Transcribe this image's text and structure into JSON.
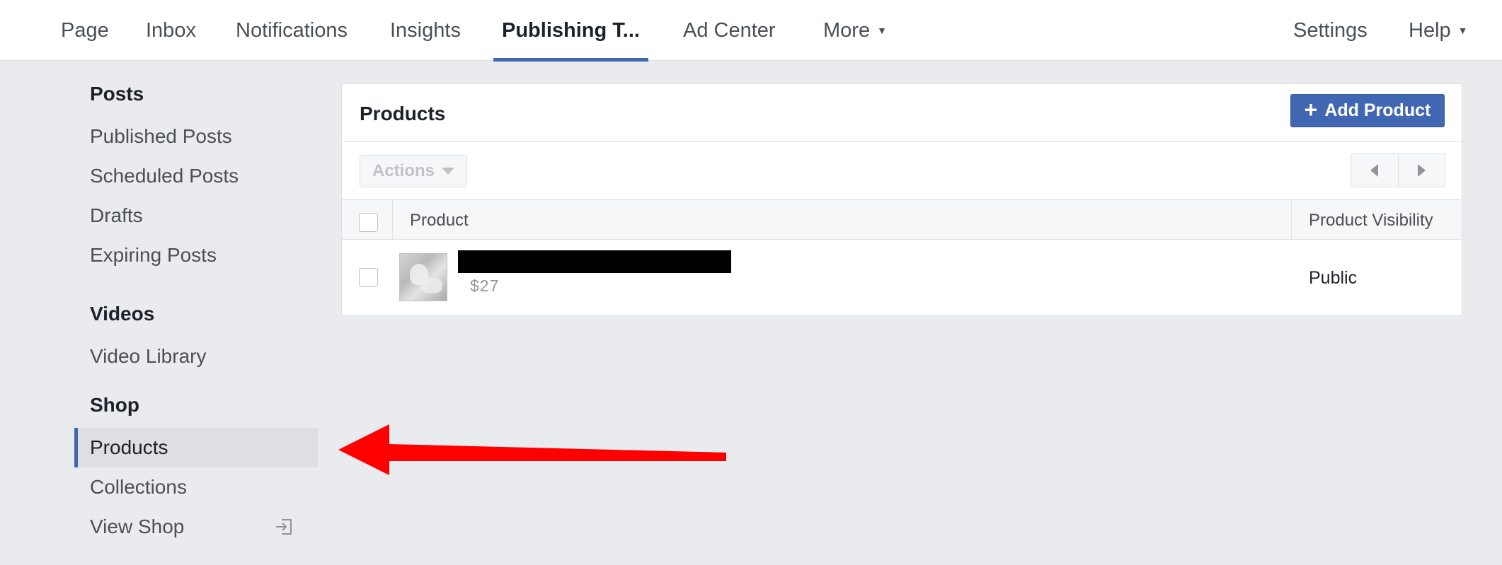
{
  "nav": {
    "items": [
      {
        "label": "Page"
      },
      {
        "label": "Inbox"
      },
      {
        "label": "Notifications"
      },
      {
        "label": "Insights"
      },
      {
        "label": "Publishing T..."
      },
      {
        "label": "Ad Center"
      },
      {
        "label": "More"
      }
    ],
    "right": [
      {
        "label": "Settings"
      },
      {
        "label": "Help"
      }
    ],
    "active_index": 4
  },
  "sidebar": {
    "posts": {
      "heading": "Posts",
      "items": [
        {
          "label": "Published Posts"
        },
        {
          "label": "Scheduled Posts"
        },
        {
          "label": "Drafts"
        },
        {
          "label": "Expiring Posts"
        }
      ]
    },
    "videos": {
      "heading": "Videos",
      "items": [
        {
          "label": "Video Library"
        }
      ]
    },
    "shop": {
      "heading": "Shop",
      "items": [
        {
          "label": "Products",
          "selected": true
        },
        {
          "label": "Collections"
        },
        {
          "label": "View Shop"
        }
      ]
    }
  },
  "products_panel": {
    "title": "Products",
    "add_button": "Add Product",
    "actions_label": "Actions",
    "columns": {
      "product": "Product",
      "visibility": "Product Visibility"
    },
    "rows": [
      {
        "price": "$27",
        "visibility": "Public",
        "name_redacted": true
      }
    ]
  },
  "colors": {
    "accent": "#4267b2",
    "background": "#e9ebee",
    "annotation_arrow": "#ff0000"
  },
  "icons": {
    "add": "plus-icon",
    "actions_caret": "caret-down-icon",
    "prev_page": "chevron-left-icon",
    "next_page": "chevron-right-icon",
    "view_shop": "external-exit-icon"
  }
}
